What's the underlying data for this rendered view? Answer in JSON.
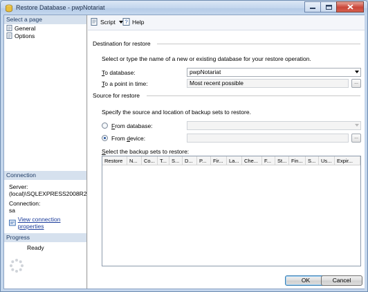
{
  "window": {
    "title": "Restore Database - pwpNotariat"
  },
  "left": {
    "select_page_header": "Select a page",
    "pages": [
      {
        "label": "General"
      },
      {
        "label": "Options"
      }
    ],
    "connection_header": "Connection",
    "server_label": "Server:",
    "server_value": "(local)\\SQLEXPRESS2008R2",
    "connection_label": "Connection:",
    "connection_value": "sa",
    "view_props_link": "View connection properties",
    "progress_header": "Progress",
    "progress_status": "Ready"
  },
  "toolbar": {
    "script_label": "Script",
    "help_label": "Help"
  },
  "destination": {
    "header": "Destination for restore",
    "instruction": "Select or type the name of a new or existing database for your restore operation.",
    "to_database_label": "To database:",
    "to_database_value": "pwpNotariat",
    "point_in_time_label": "To a point in time:",
    "point_in_time_value": "Most recent possible"
  },
  "source": {
    "header": "Source for restore",
    "instruction": "Specify the source and location of backup sets to restore.",
    "from_database_label": "From database:",
    "from_device_label": "From device:",
    "selected": "From device",
    "backup_sets_label": "Select the backup sets to restore:",
    "columns": [
      "Restore",
      "N...",
      "Co...",
      "T...",
      "S...",
      "D...",
      "P...",
      "Fir...",
      "La...",
      "Che...",
      "F...",
      "St...",
      "Fin...",
      "S...",
      "Us...",
      "Expir..."
    ]
  },
  "buttons": {
    "ok": "OK",
    "cancel": "Cancel",
    "ellipsis": "..."
  }
}
